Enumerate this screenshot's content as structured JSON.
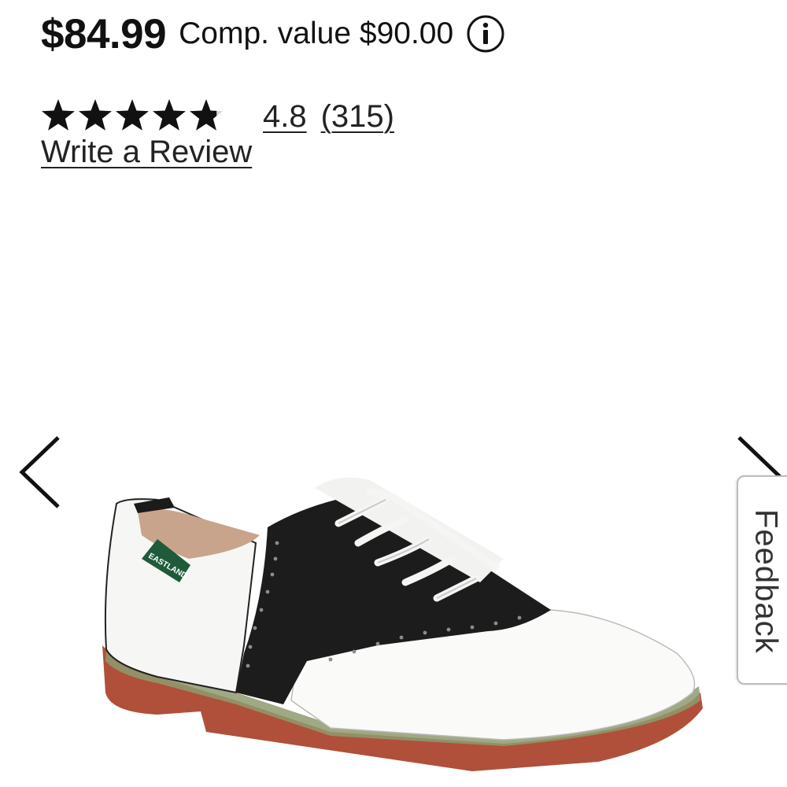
{
  "product": {
    "price": "$84.99",
    "comp_value": "Comp. value $90.00",
    "info_icon": "info-circle-icon"
  },
  "rating": {
    "stars_value": 4.8,
    "stars_max": 5,
    "value_text": "4.8",
    "count_text": "(315)",
    "write_review": "Write a Review"
  },
  "carousel": {
    "prev_icon": "chevron-left-icon",
    "next_icon": "chevron-right-icon",
    "image_brand_tag": "EASTLAND"
  },
  "feedback": {
    "label": "Feedback"
  },
  "colors": {
    "text": "#111111",
    "shoe_sole": "#b0503b",
    "shoe_saddle": "#1c1c1c",
    "brand_tag": "#1f5b3a"
  }
}
